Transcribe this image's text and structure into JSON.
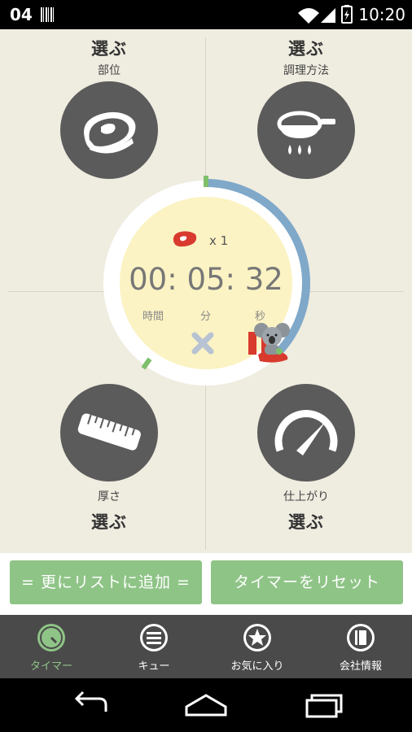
{
  "status_bar": {
    "notification_count": "04",
    "time": "10:20"
  },
  "quadrants": {
    "top_left": {
      "title": "選ぶ",
      "subtitle": "部位",
      "icon": "meat-cut-icon"
    },
    "top_right": {
      "title": "選ぶ",
      "subtitle": "調理方法",
      "icon": "frying-pan-icon"
    },
    "bottom_left": {
      "title": "選ぶ",
      "subtitle": "厚さ",
      "icon": "ruler-icon"
    },
    "bottom_right": {
      "title": "選ぶ",
      "subtitle": "仕上がり",
      "icon": "gauge-icon"
    }
  },
  "timer": {
    "multiplier": "x 1",
    "time": "00: 05: 32",
    "unit_hours": "時間",
    "unit_minutes": "分",
    "unit_seconds": "秒",
    "progress": 0.38,
    "ring_color": "#7fa8c9",
    "marker_color": "#7fbf6b"
  },
  "actions": {
    "add_to_list": "= 更にリストに追加 =",
    "reset_timer": "タイマーをリセット"
  },
  "tabs": [
    {
      "label": "タイマー",
      "icon": "timer-icon",
      "active": true
    },
    {
      "label": "キュー",
      "icon": "list-icon",
      "active": false
    },
    {
      "label": "お気に入り",
      "icon": "star-icon",
      "active": false
    },
    {
      "label": "会社情報",
      "icon": "book-icon",
      "active": false
    }
  ],
  "colors": {
    "accent_green": "#8fc487",
    "pause_red": "#d83a2e",
    "background": "#efece0"
  }
}
